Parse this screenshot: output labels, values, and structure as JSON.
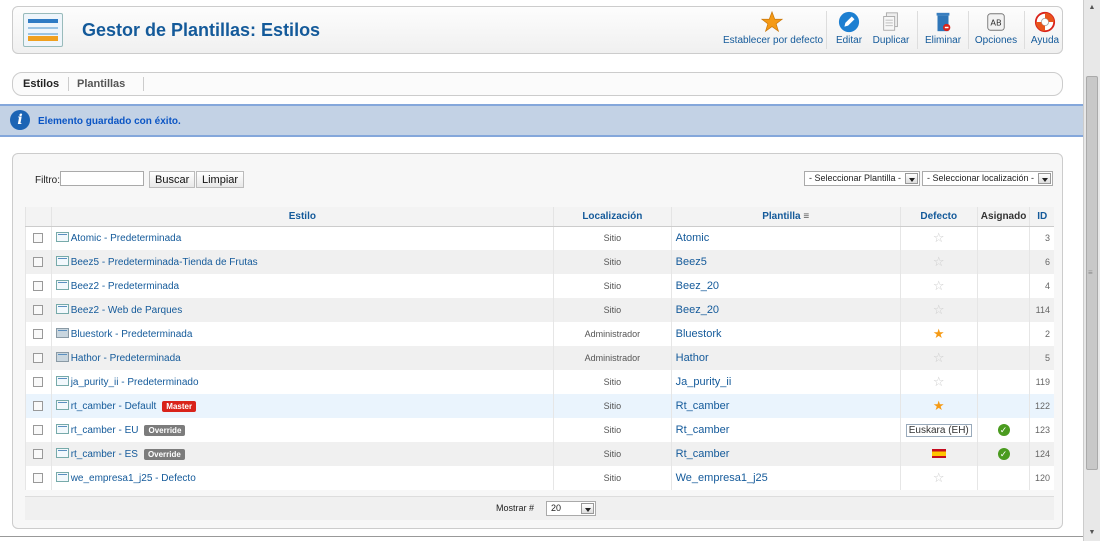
{
  "header": {
    "title": "Gestor de Plantillas: Estilos",
    "buttons": {
      "default": "Establecer por defecto",
      "edit": "Editar",
      "duplicate": "Duplicar",
      "delete": "Eliminar",
      "options": "Opciones",
      "help": "Ayuda"
    }
  },
  "submenu": {
    "styles": "Estilos",
    "templates": "Plantillas"
  },
  "message": "Elemento guardado con éxito.",
  "filter": {
    "label": "Filtro:",
    "value": "",
    "search": "Buscar",
    "clear": "Limpiar",
    "select_template": "- Seleccionar Plantilla -",
    "select_location": "- Seleccionar localización -"
  },
  "columns": {
    "style": "Estilo",
    "location": "Localización",
    "template": "Plantilla",
    "default": "Defecto",
    "assigned": "Asignado",
    "id": "ID"
  },
  "rows": [
    {
      "name": "Atomic - Predeterminada",
      "location": "Sitio",
      "template": "Atomic",
      "default": "star-off",
      "id": "3"
    },
    {
      "name": "Beez5 - Predeterminada-Tienda de Frutas",
      "location": "Sitio",
      "template": "Beez5",
      "default": "star-off",
      "id": "6"
    },
    {
      "name": "Beez2 - Predeterminada",
      "location": "Sitio",
      "template": "Beez_20",
      "default": "star-off",
      "id": "4"
    },
    {
      "name": "Beez2 - Web de Parques",
      "location": "Sitio",
      "template": "Beez_20",
      "default": "star-off",
      "id": "114"
    },
    {
      "name": "Bluestork - Predeterminada",
      "location": "Administrador",
      "template": "Bluestork",
      "default": "star-on",
      "id": "2"
    },
    {
      "name": "Hathor - Predeterminada",
      "location": "Administrador",
      "template": "Hathor",
      "default": "star-off",
      "id": "5"
    },
    {
      "name": "ja_purity_ii - Predeterminado",
      "location": "Sitio",
      "template": "Ja_purity_ii",
      "default": "star-off",
      "id": "119"
    },
    {
      "name": "rt_camber - Default",
      "badge": "Master",
      "location": "Sitio",
      "template": "Rt_camber",
      "default": "star-on",
      "id": "122"
    },
    {
      "name": "rt_camber - EU",
      "badge": "Override",
      "location": "Sitio",
      "template": "Rt_camber",
      "default_text": "Euskara (EH)",
      "assigned": true,
      "id": "123"
    },
    {
      "name": "rt_camber - ES",
      "badge": "Override",
      "location": "Sitio",
      "template": "Rt_camber",
      "default": "flag-es",
      "assigned": true,
      "id": "124"
    },
    {
      "name": "we_empresa1_j25 - Defecto",
      "location": "Sitio",
      "template": "We_empresa1_j25",
      "default": "star-off",
      "id": "120"
    }
  ],
  "pagination": {
    "label": "Mostrar #",
    "value": "20"
  },
  "colors": {
    "accent": "#145a9a",
    "message_bg": "#c3d2e5",
    "star": "#f59a15",
    "master": "#d9231a"
  }
}
